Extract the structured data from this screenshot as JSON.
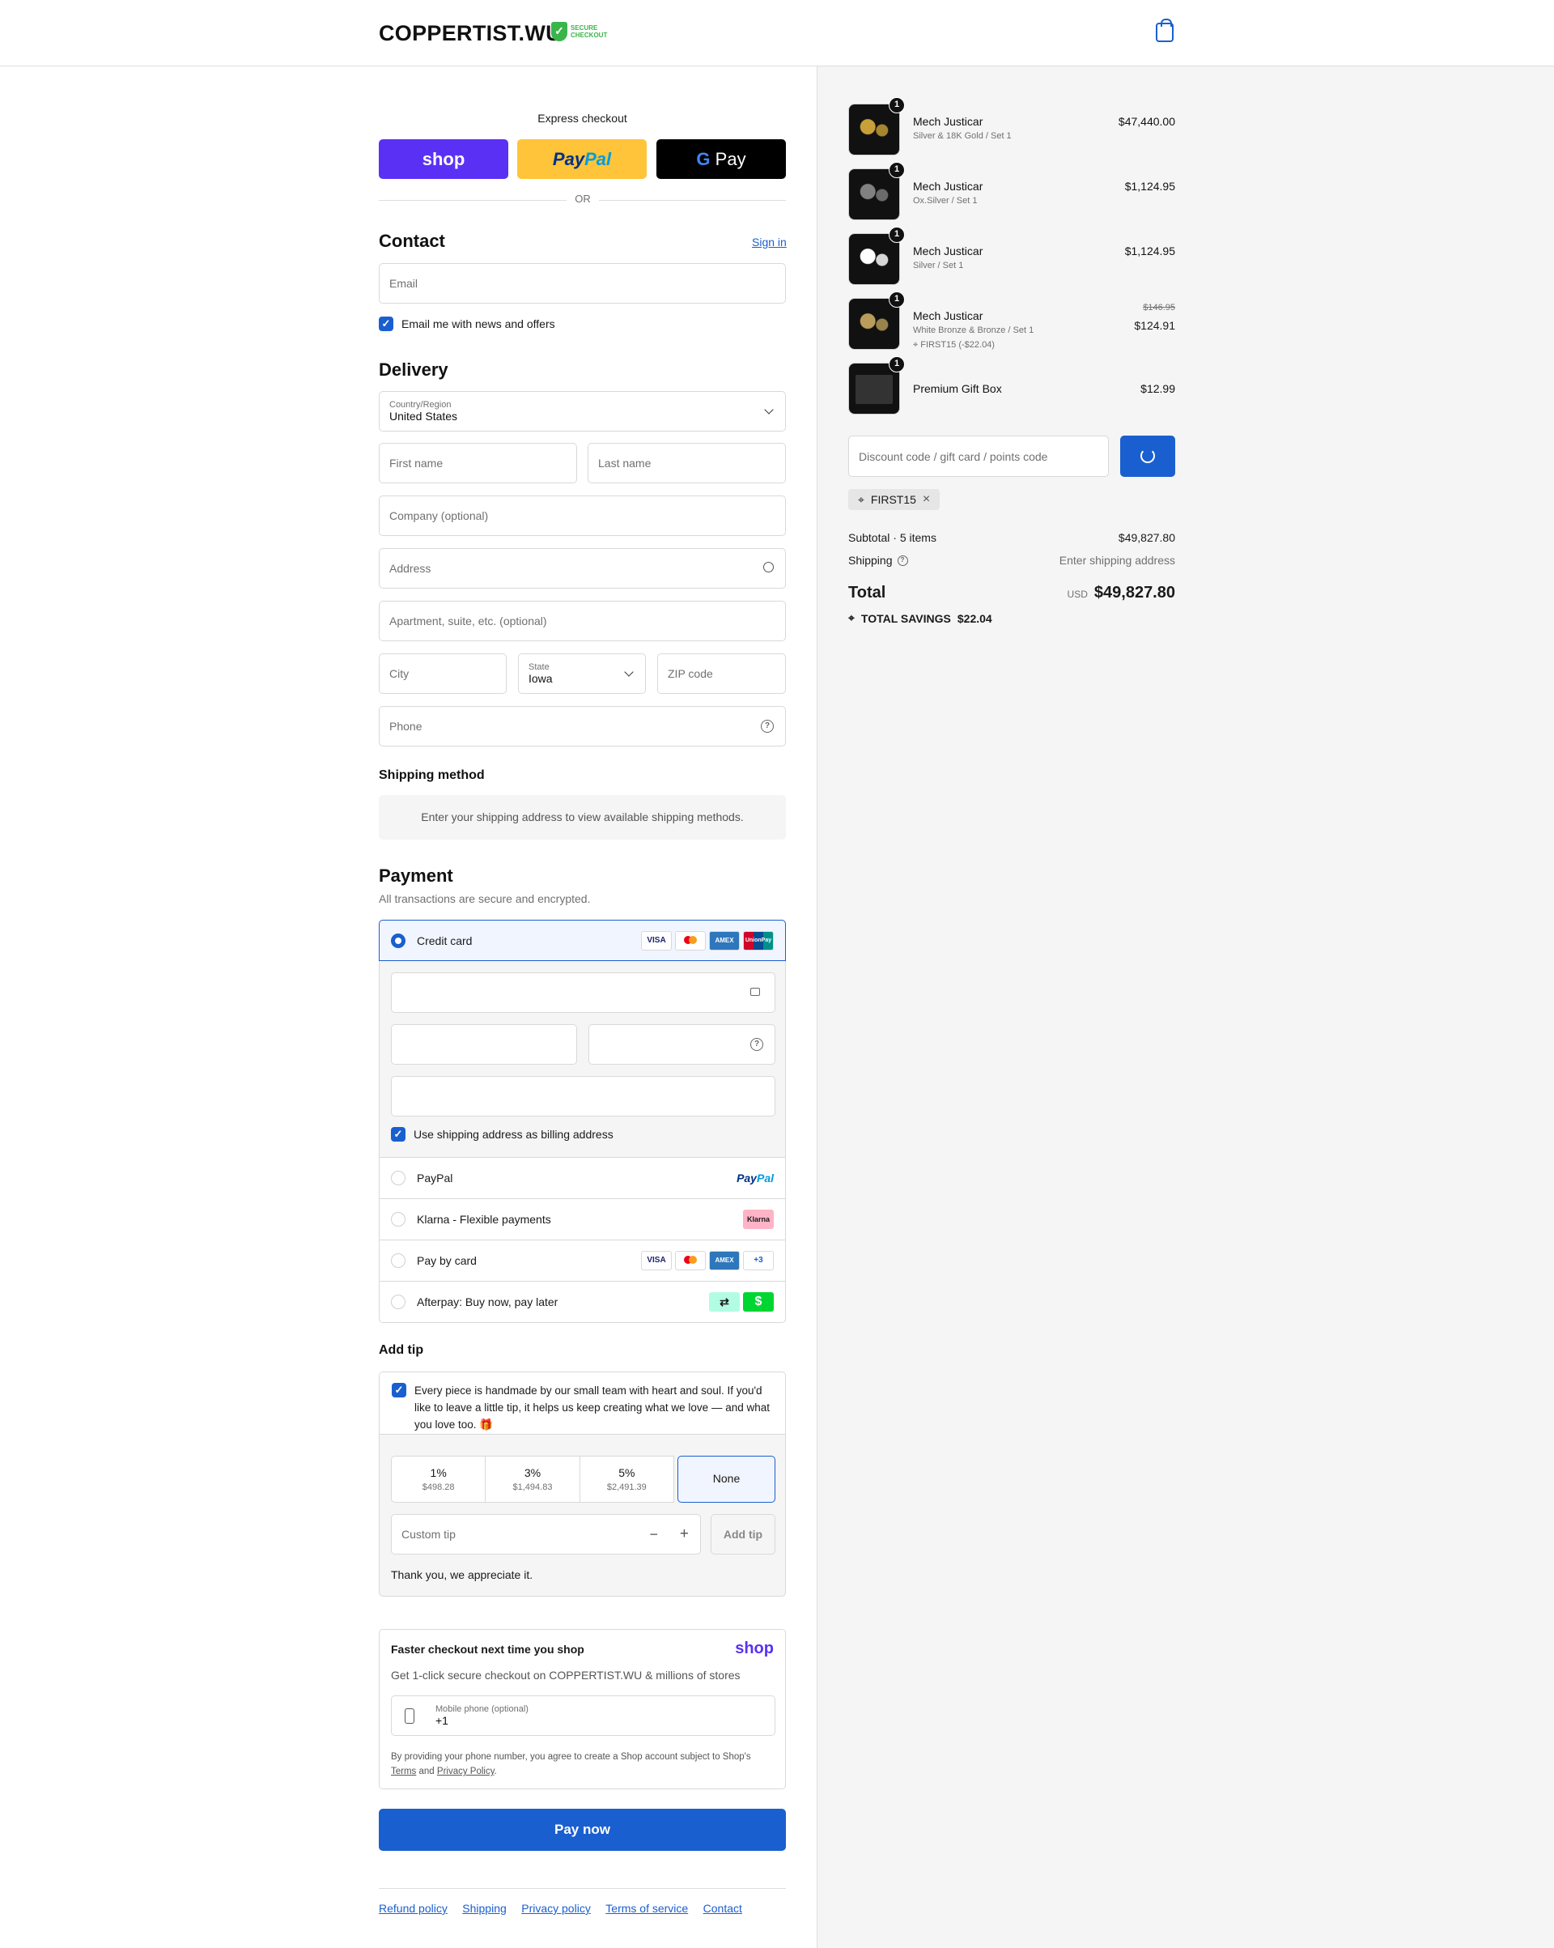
{
  "brand": {
    "logo": "COPPERTIST.WU",
    "secure_line1": "SECURE",
    "secure_line2": "CHECKOUT"
  },
  "express": {
    "title": "Express checkout",
    "shop": "shop",
    "paypal": "PayPal",
    "gpay": "Pay",
    "or": "OR"
  },
  "contact": {
    "title": "Contact",
    "sign_in": "Sign in",
    "email_placeholder": "Email",
    "news_label": "Email me with news and offers"
  },
  "delivery": {
    "title": "Delivery",
    "country_label": "Country/Region",
    "country_value": "United States",
    "first_name": "First name",
    "last_name": "Last name",
    "company": "Company (optional)",
    "address": "Address",
    "apartment": "Apartment, suite, etc. (optional)",
    "city": "City",
    "state_label": "State",
    "state_value": "Iowa",
    "zip": "ZIP code",
    "phone": "Phone"
  },
  "shipping_method": {
    "title": "Shipping method",
    "notice": "Enter your shipping address to view available shipping methods."
  },
  "payment": {
    "title": "Payment",
    "subtitle": "All transactions are secure and encrypted.",
    "credit_card": "Credit card",
    "billing_label": "Use shipping address as billing address",
    "paypal": "PayPal",
    "klarna": "Klarna - Flexible payments",
    "klarna_badge": "Klarna",
    "pay_by_card": "Pay by card",
    "more_cards": "+3",
    "afterpay": "Afterpay: Buy now, pay later"
  },
  "tip": {
    "title": "Add tip",
    "message": "Every piece is handmade by our small team with heart and soul. If you'd like to leave a little tip, it helps us keep creating what we love — and what you love too. 🎁",
    "options": [
      {
        "pct": "1%",
        "amt": "$498.28"
      },
      {
        "pct": "3%",
        "amt": "$1,494.83"
      },
      {
        "pct": "5%",
        "amt": "$2,491.39"
      }
    ],
    "none": "None",
    "custom_placeholder": "Custom tip",
    "add_button": "Add tip",
    "thanks": "Thank you, we appreciate it."
  },
  "shop_pay": {
    "title": "Faster checkout next time you shop",
    "logo": "shop",
    "subtitle": "Get 1-click secure checkout on COPPERTIST.WU & millions of stores",
    "phone_label": "Mobile phone (optional)",
    "phone_value": "+1",
    "legal_prefix": "By providing your phone number, you agree to create a Shop account subject to Shop's",
    "terms": "Terms",
    "and": "and",
    "privacy": "Privacy Policy",
    "period": "."
  },
  "pay_now": "Pay now",
  "footer": [
    "Refund policy",
    "Shipping",
    "Privacy policy",
    "Terms of service",
    "Contact"
  ],
  "order": {
    "items": [
      {
        "name": "Mech Justicar",
        "variant": "Silver & 18K Gold / Set 1",
        "price": "$47,440.00",
        "qty": "1"
      },
      {
        "name": "Mech Justicar",
        "variant": "Ox.Silver / Set 1",
        "price": "$1,124.95",
        "qty": "1"
      },
      {
        "name": "Mech Justicar",
        "variant": "Silver / Set 1",
        "price": "$1,124.95",
        "qty": "1"
      },
      {
        "name": "Mech Justicar",
        "variant": "White Bronze & Bronze / Set 1",
        "discount": "FIRST15 (-$22.04)",
        "old_price": "$146.95",
        "price": "$124.91",
        "qty": "1"
      },
      {
        "name": "Premium Gift Box",
        "variant": "",
        "price": "$12.99",
        "qty": "1"
      }
    ],
    "discount_placeholder": "Discount code / gift card / points code",
    "applied_code": "FIRST15",
    "subtotal_label": "Subtotal · 5 items",
    "subtotal": "$49,827.80",
    "shipping_label": "Shipping",
    "shipping_value": "Enter shipping address",
    "total_label": "Total",
    "currency": "USD",
    "total": "$49,827.80",
    "savings_label": "TOTAL SAVINGS",
    "savings": "$22.04"
  }
}
